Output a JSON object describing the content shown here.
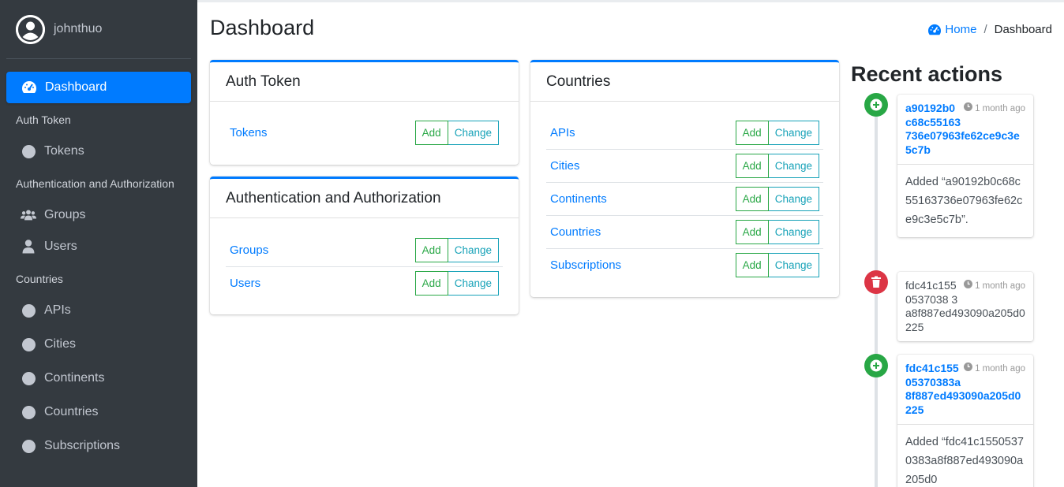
{
  "user": {
    "name": "johnthuo"
  },
  "sidebar": {
    "active": {
      "label": "Dashboard"
    },
    "groups": [
      {
        "header": "Auth Token",
        "items": [
          {
            "label": "Tokens",
            "icon": "circle-icon"
          }
        ]
      },
      {
        "header": "Authentication and Authorization",
        "items": [
          {
            "label": "Groups",
            "icon": "users-icon"
          },
          {
            "label": "Users",
            "icon": "user-icon"
          }
        ]
      },
      {
        "header": "Countries",
        "items": [
          {
            "label": "APIs"
          },
          {
            "label": "Cities"
          },
          {
            "label": "Continents"
          },
          {
            "label": "Countries"
          },
          {
            "label": "Subscriptions"
          }
        ]
      }
    ]
  },
  "page": {
    "title": "Dashboard"
  },
  "breadcrumb": {
    "home": "Home",
    "separator": "/",
    "current": "Dashboard"
  },
  "buttons": {
    "add": "Add",
    "change": "Change"
  },
  "apps": [
    {
      "title": "Auth Token",
      "models": [
        "Tokens"
      ]
    },
    {
      "title": "Authentication and Authorization",
      "models": [
        "Groups",
        "Users"
      ]
    },
    {
      "title": "Countries",
      "models": [
        "APIs",
        "Cities",
        "Continents",
        "Countries",
        "Subscriptions"
      ]
    }
  ],
  "recent": {
    "title": "Recent actions",
    "items": [
      {
        "type": "add",
        "object": "a90192b0c68c55163736e07963fe62ce9c3e5c7b",
        "time": "1 month ago",
        "message": "Added “a90192b0c68c55163736e07963fe62ce9c3e5c7b”."
      },
      {
        "type": "delete",
        "object": "fdc41c1550537038 3a8f887ed493090a205d0225",
        "time": "1 month ago"
      },
      {
        "type": "add",
        "object": "fdc41c15505370383a8f887ed493090a205d0225",
        "time": "1 month ago",
        "message": "Added “fdc41c15505370383a8f887ed493090a205d0"
      }
    ]
  },
  "colors": {
    "primary": "#007bff",
    "success": "#28a745",
    "info": "#17a2b8",
    "danger": "#dc3545",
    "sidebar": "#343a40"
  }
}
